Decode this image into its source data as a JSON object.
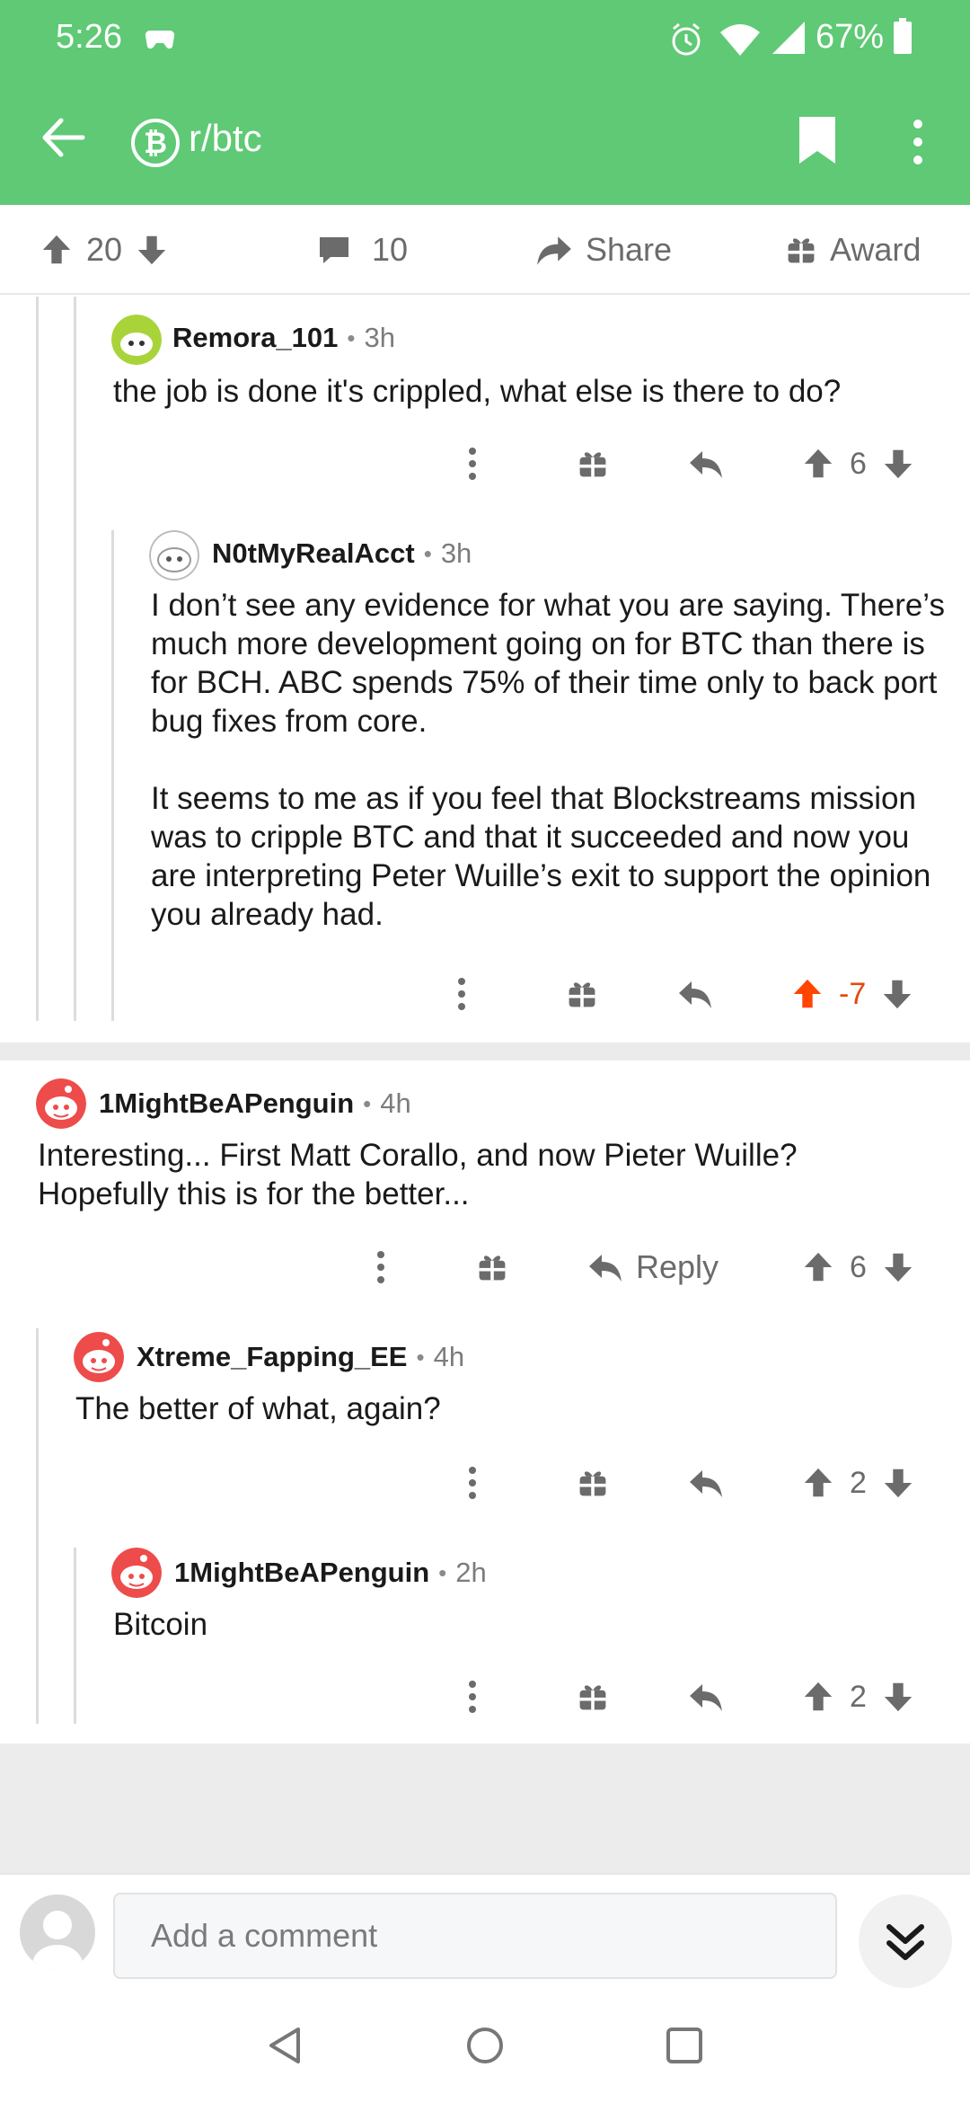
{
  "status_bar": {
    "time": "5:26",
    "battery": "67%"
  },
  "header": {
    "subreddit": "r/btc",
    "badge_glyph": "₿"
  },
  "post_actions": {
    "upvotes": "20",
    "comments": "10",
    "share_label": "Share",
    "award_label": "Award"
  },
  "comments": [
    {
      "user": "Remora_101",
      "age": "3h",
      "body": [
        "the job is done it's crippled, what else is there to do?"
      ],
      "votes": "6"
    },
    {
      "user": "N0tMyRealAcct",
      "age": "3h",
      "body": [
        "I don’t see any evidence for what you are saying. There’s much more development going on for BTC than there is for BCH. ABC spends 75% of their time only to back port bug fixes from core.",
        "It seems to me as if you feel that Blockstreams mission was to cripple BTC and that it succeeded and now you are interpreting Peter Wuille’s exit to support the opinion you already had."
      ],
      "votes": "-7",
      "upvoted": true
    },
    {
      "user": "1MightBeAPenguin",
      "age": "4h",
      "body": [
        "Interesting... First Matt Corallo, and now Pieter Wuille? Hopefully this is for the better..."
      ],
      "votes": "6",
      "reply_label": "Reply"
    },
    {
      "user": "Xtreme_Fapping_EE",
      "age": "4h",
      "body": [
        "The better of what, again?"
      ],
      "votes": "2"
    },
    {
      "user": "1MightBeAPenguin",
      "age": "2h",
      "body": [
        "Bitcoin"
      ],
      "votes": "2"
    }
  ],
  "composer": {
    "placeholder": "Add a comment"
  },
  "colors": {
    "header_green": "#5fc975",
    "upvote_orange": "#ff4500",
    "icon_gray": "#6b6b6b"
  }
}
